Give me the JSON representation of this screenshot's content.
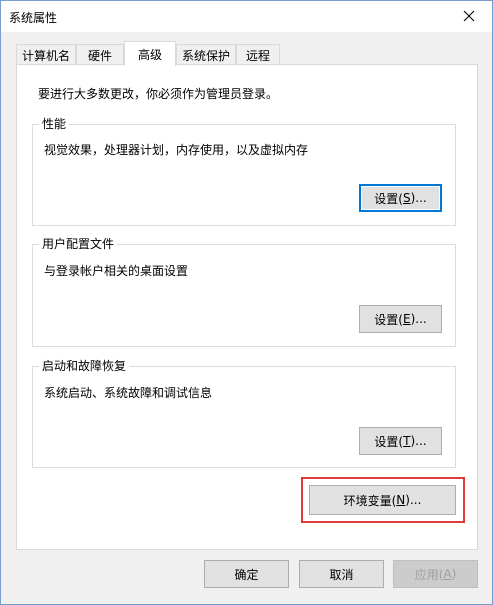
{
  "window": {
    "title": "系统属性",
    "close_glyph": "✕"
  },
  "tabs": [
    {
      "label": "计算机名",
      "active": false
    },
    {
      "label": "硬件",
      "active": false
    },
    {
      "label": "高级",
      "active": true
    },
    {
      "label": "系统保护",
      "active": false
    },
    {
      "label": "远程",
      "active": false
    }
  ],
  "advanced": {
    "admin_note": "要进行大多数更改，你必须作为管理员登录。",
    "performance": {
      "title": "性能",
      "description": "视觉效果，处理器计划，内存使用，以及虚拟内存",
      "button_prefix": "设置(",
      "button_key": "S",
      "button_suffix": ")..."
    },
    "user_profiles": {
      "title": "用户配置文件",
      "description": "与登录帐户相关的桌面设置",
      "button_prefix": "设置(",
      "button_key": "E",
      "button_suffix": ")..."
    },
    "startup_recovery": {
      "title": "启动和故障恢复",
      "description": "系统启动、系统故障和调试信息",
      "button_prefix": "设置(",
      "button_key": "T",
      "button_suffix": ")..."
    },
    "env_vars": {
      "prefix": "环境变量(",
      "key": "N",
      "suffix": ")..."
    }
  },
  "footer": {
    "ok": "确定",
    "cancel": "取消",
    "apply_prefix": "应用(",
    "apply_key": "A",
    "apply_suffix": ")"
  },
  "colors": {
    "highlight_box": "#e03a3a",
    "focus_ring": "#0078d7"
  }
}
